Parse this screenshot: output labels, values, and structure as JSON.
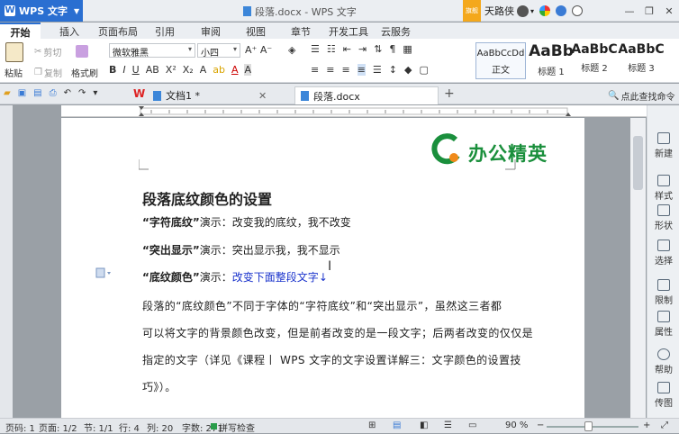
{
  "titlebar": {
    "app_name": "WPS 文字",
    "window_title": "段落.docx - WPS 文字",
    "vip": "旗舰",
    "username": "天路侠"
  },
  "tabs": [
    "开始",
    "插入",
    "页面布局",
    "引用",
    "审阅",
    "视图",
    "章节",
    "开发工具",
    "云服务"
  ],
  "ribbon": {
    "paste": "粘贴",
    "cut": "剪切",
    "copy": "复制",
    "format_painter": "格式刷",
    "font_name": "微软雅黑",
    "font_size": "小四",
    "styles": [
      {
        "preview": "AaBbCcDd",
        "name": "正文"
      },
      {
        "preview": "AaBb",
        "name": "标题 1"
      },
      {
        "preview": "AaBbC",
        "name": "标题 2"
      },
      {
        "preview": "AaBbC",
        "name": "标题 3"
      }
    ]
  },
  "doc_tabs": [
    {
      "label": "文档1 *"
    },
    {
      "label": "段落.docx"
    }
  ],
  "search_cmd": "点此查找命令",
  "document": {
    "logo_text": "办公精英",
    "title": "段落底纹颜色的设置",
    "line1_bold": "“字符底纹”",
    "line1_rest": "演示：改变我的底纹，我不改变",
    "line2_bold": "“突出显示”",
    "line2_rest": "演示：突出显示我，我不显示",
    "line3_bold": "“底纹颜色”",
    "line3_rest": "演示：",
    "line3_blue": "改变下面整段文字",
    "para": [
      "段落的“底纹颜色”不同于字体的“字符底纹”和“突出显示”，虽然这三者都",
      "可以将文字的背景颜色改变，但是前者改变的是一段文字；后两者改变的仅仅是",
      "指定的文字（详见《课程丨 WPS 文字的文字设置详解三：文字颜色的设置技",
      "巧》）。"
    ]
  },
  "right_panel": [
    "新建",
    "样式",
    "形状",
    "选择",
    "限制",
    "属性",
    "帮助",
    "传图"
  ],
  "status": {
    "page_num": "页码: 1",
    "page_of": "页面: 1/2",
    "section": "节: 1/1",
    "row": "行: 4",
    "col": "列: 20",
    "word_count": "字数: 271",
    "spell_check": "拼写检查",
    "zoom": "90 %"
  },
  "colors": {
    "accent": "#2a6fd1",
    "logo_green": "#1a8f3c",
    "logo_orange": "#f08a1a",
    "blue_text": "#1a33cc"
  },
  "icons": [
    "wps-logo-icon",
    "minimize-icon",
    "maximize-icon",
    "close-icon",
    "scissors-icon",
    "copy-icon",
    "brush-icon",
    "bold-icon",
    "italic-icon",
    "underline-icon",
    "align-left-icon",
    "align-center-icon",
    "align-right-icon",
    "justify-icon",
    "search-icon"
  ]
}
